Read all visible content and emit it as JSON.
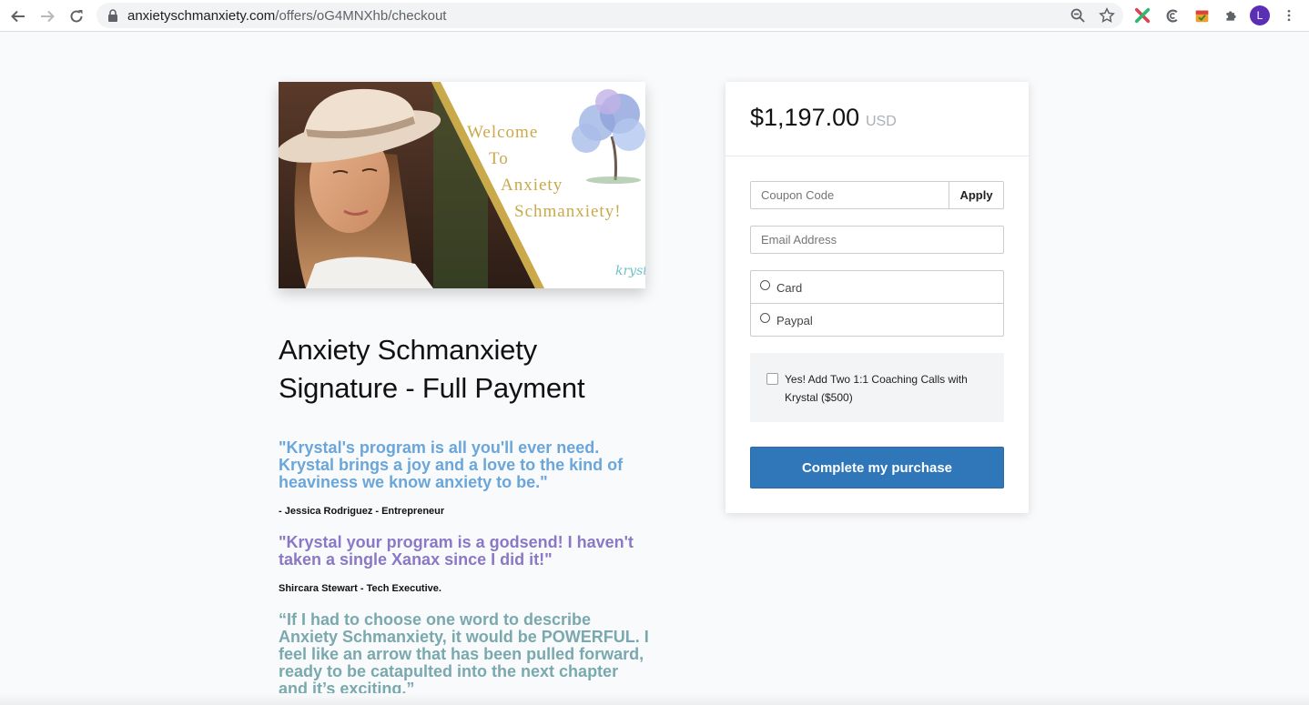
{
  "browser": {
    "url_domain": "anxietyschmanxiety.com",
    "url_path": "/offers/oG4MNXhb/checkout",
    "profile_initial": "L"
  },
  "hero": {
    "banner_lines": [
      "Welcome",
      "To",
      "Anxiety",
      "Schmanxiety!"
    ],
    "signature": "krysta"
  },
  "product": {
    "title": "Anxiety Schmanxiety Signature - Full Payment"
  },
  "testimonials": [
    {
      "quote": "\"Krystal's program is all you'll ever need. Krystal brings a joy and a love to the kind of heaviness we know anxiety to be.\"",
      "author": "- Jessica Rodriguez - Entrepreneur"
    },
    {
      "quote": "\"Krystal your program is a godsend! I haven't taken a single Xanax since I did it!\"",
      "author": "Shircara Stewart - Tech Executive."
    },
    {
      "quote": "“If I had to choose one word to describe Anxiety Schmanxiety, it would be POWERFUL. I feel like an arrow that has been pulled forward, ready to be catapulted into the next chapter and it’s exciting.”"
    }
  ],
  "checkout": {
    "price": "$1,197.00",
    "currency": "USD",
    "coupon_placeholder": "Coupon Code",
    "apply_label": "Apply",
    "email_placeholder": "Email Address",
    "payment_options": [
      "Card",
      "Paypal"
    ],
    "addon_label": "Yes! Add Two 1:1 Coaching Calls with Krystal ($500)",
    "addon_checked": false,
    "submit_label": "Complete my purchase"
  },
  "colors": {
    "accent_button": "#2f77b8",
    "quote1": "#6aa6da",
    "quote2": "#8a78c6",
    "quote3": "#79a9ae",
    "banner_gold": "#c9a94a"
  }
}
